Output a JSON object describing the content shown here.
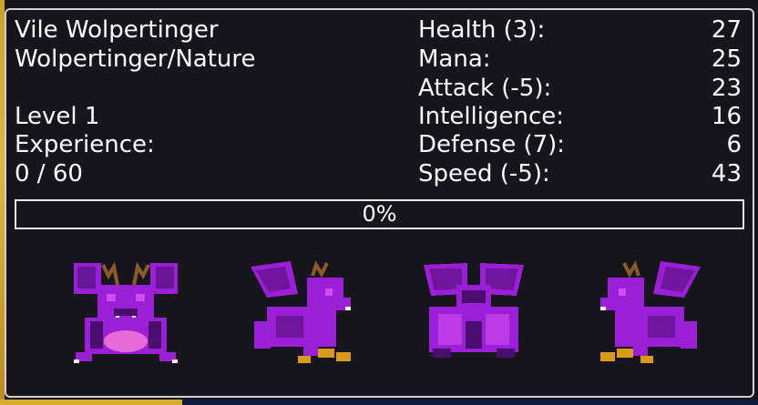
{
  "creature": {
    "name": "Vile Wolpertinger",
    "type": "Wolpertinger/Nature",
    "level": "Level 1",
    "experience_label": "Experience:",
    "experience_value": "0 / 60"
  },
  "stats": [
    {
      "label": "Health (3):",
      "value": "27"
    },
    {
      "label": "Mana:",
      "value": "25"
    },
    {
      "label": "Attack (-5):",
      "value": "23"
    },
    {
      "label": "Intelligence:",
      "value": "16"
    },
    {
      "label": "Defense (7):",
      "value": "6"
    },
    {
      "label": "Speed (-5):",
      "value": "43"
    }
  ],
  "xp_bar": {
    "label": "0%",
    "fraction": 0
  },
  "sprites": [
    "front-view",
    "right-side-view",
    "back-view",
    "left-side-view"
  ],
  "colors": {
    "panel_bg": "#17161c",
    "border": "#cfcfd4",
    "text": "#ffffff",
    "sprite_main": "#9b1fd6",
    "sprite_dark": "#4a0f6e",
    "sprite_light": "#d24df0",
    "antler": "#8a5a2b"
  }
}
